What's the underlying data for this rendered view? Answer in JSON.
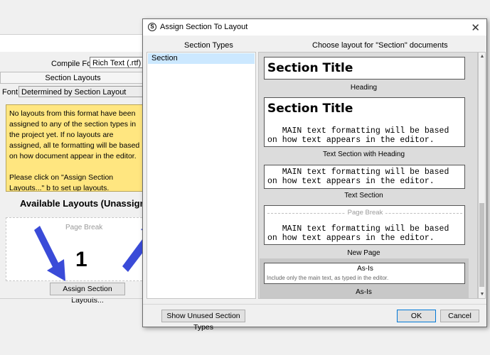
{
  "background_window": {
    "compile_for_label": "Compile For:",
    "compile_for_value": "Rich Text (.rtf)",
    "section_layouts_header": "Section Layouts",
    "font_label": "Font:",
    "font_value": "Determined by Section Layout",
    "notice_text": "No layouts from this format have been assigned to any of the section types in the project yet. If no layouts are assigned, all te formatting will be based on how document appear in the editor.\n\nPlease click on \"Assign Section Layouts...\" b to set up layouts.",
    "available_layouts_title": "Available Layouts (Unassigned",
    "page_break_text": "Page Break",
    "annotation_number": "1",
    "assign_button_label": "Assign Section Layouts..."
  },
  "dialog": {
    "title": "Assign Section To Layout",
    "section_types_header": "Section Types",
    "choose_layout_header": "Choose layout for \"Section\" documents",
    "section_types": [
      "Section"
    ],
    "layouts": {
      "heading": {
        "title": "Section Title",
        "label": "Heading"
      },
      "text_with_heading": {
        "title": "Section Title",
        "body": "   MAIN text formatting will be based\non how text appears in the editor.",
        "label": "Text Section with Heading"
      },
      "text_section": {
        "body": "   MAIN text formatting will be based\non how text appears in the editor.",
        "label": "Text Section"
      },
      "new_page": {
        "page_break": "Page Break",
        "body": "   MAIN text formatting will be based\non how text appears in the editor.",
        "label": "New Page"
      },
      "as_is": {
        "title": "As-Is",
        "description": "Include only the main text, as typed in the editor.",
        "label": "As-Is"
      }
    },
    "show_unused_button": "Show Unused Section Types",
    "ok_button": "OK",
    "cancel_button": "Cancel"
  },
  "colors": {
    "notice_bg": "#ffe680",
    "selection": "#cce8ff",
    "arrow": "#3a4bd8"
  }
}
